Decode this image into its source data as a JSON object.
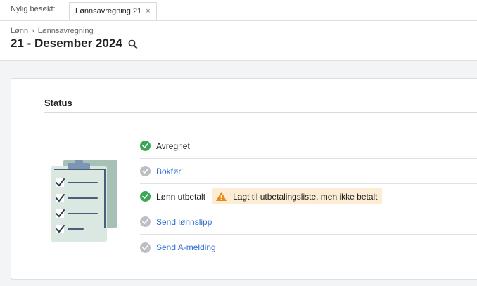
{
  "topbar": {
    "recent_label": "Nylig besøkt:",
    "tab_label": "Lønnsavregning 21",
    "tab_close": "×"
  },
  "header": {
    "breadcrumb": [
      "Lønn",
      "Lønnsavregning"
    ],
    "breadcrumb_separator": "›",
    "title": "21 - Desember 2024"
  },
  "status": {
    "heading": "Status",
    "steps": [
      {
        "label": "Avregnet",
        "done": true,
        "link": false
      },
      {
        "label": "Bokfør",
        "done": false,
        "link": true
      },
      {
        "label": "Lønn utbetalt",
        "done": true,
        "link": false,
        "warning": "Lagt til utbetalingsliste, men ikke betalt"
      },
      {
        "label": "Send lønnslipp",
        "done": false,
        "link": true
      },
      {
        "label": "Send A-melding",
        "done": false,
        "link": true
      }
    ]
  },
  "colors": {
    "done": "#3aa757",
    "todo": "#bcbfc3",
    "link": "#2f6fd0",
    "warning_bg": "#fbecd3",
    "warning_icon": "#e8891c"
  },
  "icons": {
    "search": "search-icon",
    "close": "close-icon",
    "check": "check-circle-icon",
    "warning": "warning-icon"
  }
}
